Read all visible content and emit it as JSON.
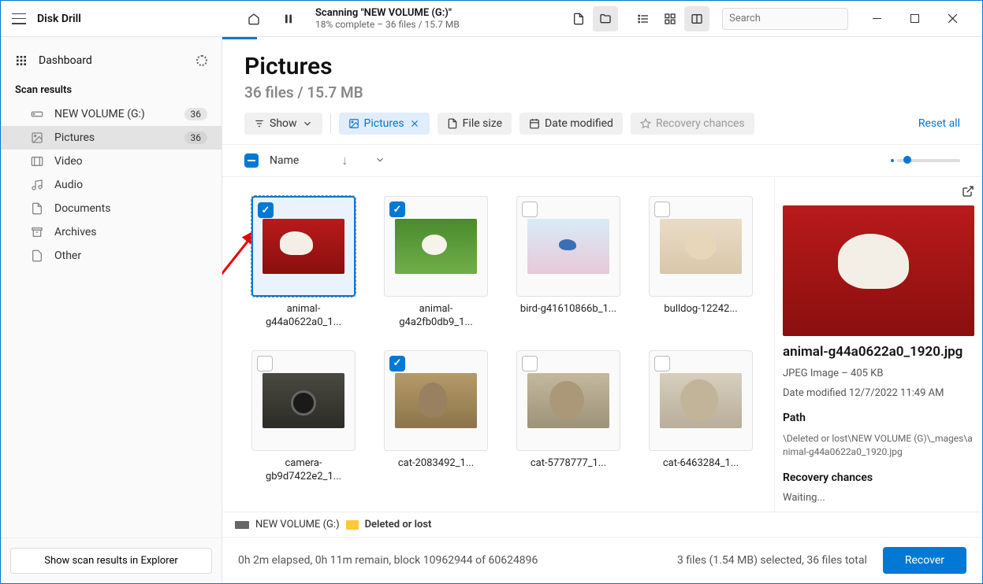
{
  "app_name": "Disk Drill",
  "scan": {
    "title": "Scanning \"NEW VOLUME (G:)\"",
    "subtitle": "18% complete – 36 files / 15.7 MB"
  },
  "search": {
    "placeholder": "Search"
  },
  "sidebar": {
    "dashboard": "Dashboard",
    "section": "Scan results",
    "items": [
      {
        "label": "NEW VOLUME (G:)",
        "badge": "36",
        "icon": "drive"
      },
      {
        "label": "Pictures",
        "badge": "36",
        "icon": "picture",
        "selected": true
      },
      {
        "label": "Video",
        "icon": "video"
      },
      {
        "label": "Audio",
        "icon": "audio"
      },
      {
        "label": "Documents",
        "icon": "doc"
      },
      {
        "label": "Archives",
        "icon": "archive"
      },
      {
        "label": "Other",
        "icon": "other"
      }
    ],
    "footer_btn": "Show scan results in Explorer"
  },
  "page": {
    "title": "Pictures",
    "subtitle": "36 files / 15.7 MB"
  },
  "filters": {
    "show": "Show",
    "pictures": "Pictures",
    "filesize": "File size",
    "datemod": "Date modified",
    "recovery": "Recovery chances",
    "reset": "Reset all"
  },
  "columns": {
    "name": "Name"
  },
  "files": [
    {
      "name": "animal-g44a0622a0_1...",
      "art": "art-dogred",
      "checked": true,
      "selected": true
    },
    {
      "name": "animal-g4a2fb0db9_1...",
      "art": "art-doggrass",
      "checked": true
    },
    {
      "name": "bird-g41610866b_1...",
      "art": "art-bird"
    },
    {
      "name": "bulldog-12242...",
      "art": "art-bulldog"
    },
    {
      "name": "camera-gb9d7422e2_1...",
      "art": "art-camera"
    },
    {
      "name": "cat-2083492_1...",
      "art": "art-cat1",
      "checked": true
    },
    {
      "name": "cat-5778777_1...",
      "art": "art-cat2"
    },
    {
      "name": "cat-6463284_1...",
      "art": "art-cat3"
    }
  ],
  "preview": {
    "filename": "animal-g44a0622a0_1920.jpg",
    "meta": "JPEG Image – 405 KB",
    "date": "Date modified 12/7/2022 11:49 AM",
    "path_title": "Path",
    "path": "\\Deleted or lost\\NEW VOLUME (G)\\_mages\\animal-g44a0622a0_1920.jpg",
    "rc_title": "Recovery chances",
    "rc_value": "Waiting..."
  },
  "breadcrumb": {
    "drive": "NEW VOLUME (G:)",
    "folder": "Deleted or lost"
  },
  "status": {
    "left": "0h 2m elapsed, 0h 11m remain, block 10962944 of 60624896",
    "right": "3 files (1.54 MB) selected, 36 files total",
    "recover": "Recover"
  }
}
